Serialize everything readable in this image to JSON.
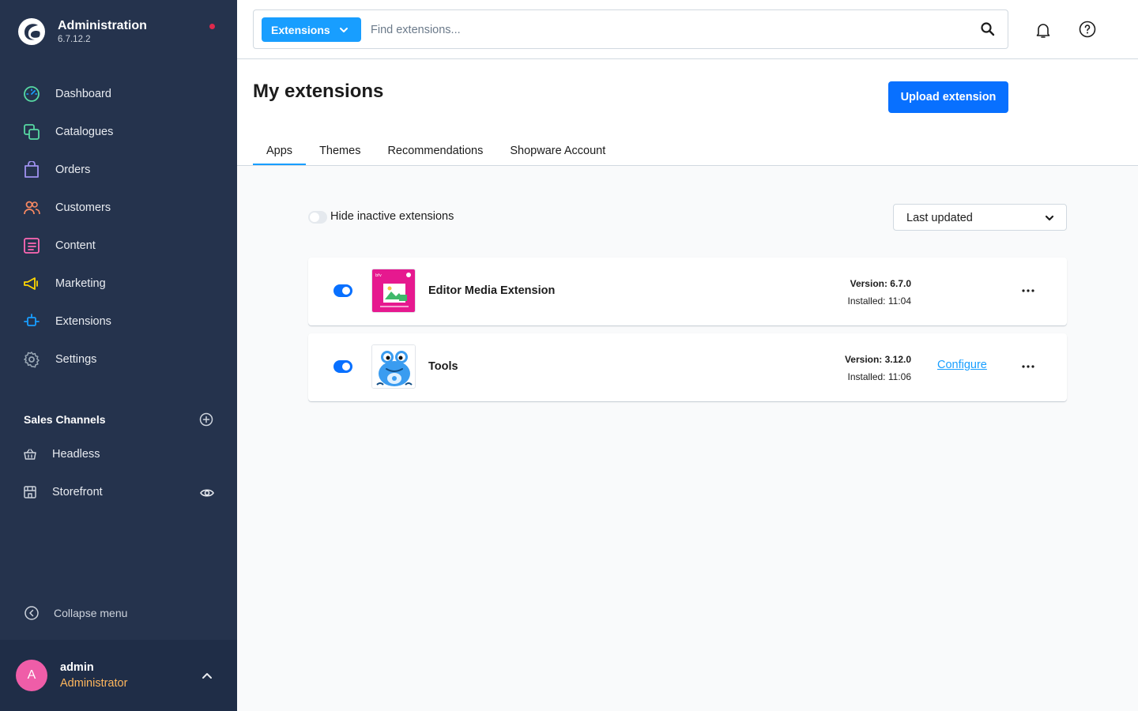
{
  "app": {
    "title": "Administration",
    "version": "6.7.12.2"
  },
  "sidebar": {
    "items": [
      {
        "label": "Dashboard",
        "icon": "dashboard-icon",
        "color": "#57d9a3"
      },
      {
        "label": "Catalogues",
        "icon": "catalogues-icon",
        "color": "#57d9a3"
      },
      {
        "label": "Orders",
        "icon": "orders-icon",
        "color": "#a092f0"
      },
      {
        "label": "Customers",
        "icon": "customers-icon",
        "color": "#f88962"
      },
      {
        "label": "Content",
        "icon": "content-icon",
        "color": "#ff68b4"
      },
      {
        "label": "Marketing",
        "icon": "marketing-icon",
        "color": "#ffd700"
      },
      {
        "label": "Extensions",
        "icon": "extensions-icon",
        "color": "#189eff"
      },
      {
        "label": "Settings",
        "icon": "settings-icon",
        "color": "#9aa8b5"
      }
    ],
    "sales_channels": {
      "title": "Sales Channels",
      "items": [
        {
          "label": "Headless",
          "icon": "basket-icon"
        },
        {
          "label": "Storefront",
          "icon": "storefront-icon"
        }
      ]
    },
    "collapse_label": "Collapse menu"
  },
  "user": {
    "initial": "A",
    "name": "admin",
    "role": "Administrator"
  },
  "search": {
    "type_label": "Extensions",
    "placeholder": "Find extensions..."
  },
  "page": {
    "title": "My extensions",
    "upload_label": "Upload extension",
    "tabs": [
      {
        "label": "Apps",
        "active": true
      },
      {
        "label": "Themes",
        "active": false
      },
      {
        "label": "Recommendations",
        "active": false
      },
      {
        "label": "Shopware Account",
        "active": false
      }
    ]
  },
  "filters": {
    "hide_inactive_label": "Hide inactive extensions",
    "hide_inactive_on": false,
    "sort_value": "Last updated"
  },
  "extensions": [
    {
      "name": "Editor Media Extension",
      "version": "Version: 6.7.0",
      "installed": "Installed: 11:04",
      "active": true,
      "configure_label": "",
      "icon": "editor-media-icon"
    },
    {
      "name": "Tools",
      "version": "Version: 3.12.0",
      "installed": "Installed: 11:06",
      "active": true,
      "configure_label": "Configure",
      "icon": "frog-icon"
    }
  ],
  "colors": {
    "sidebar_bg": "#25334d",
    "accent": "#189eff",
    "primary_button": "#0870ff",
    "notification_dot": "#de294c",
    "avatar": "#ef5da8",
    "role": "#ffb75d"
  }
}
